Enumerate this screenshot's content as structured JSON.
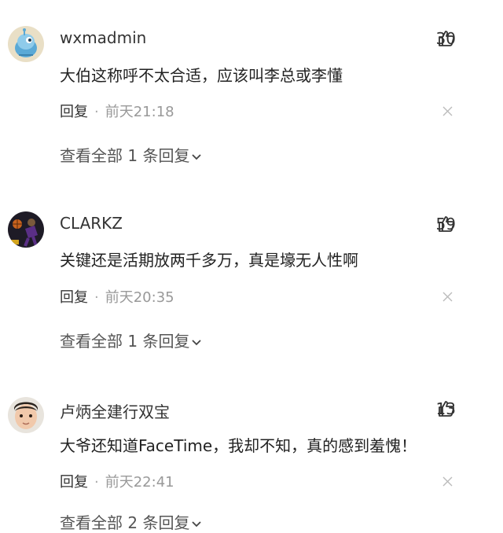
{
  "comments": [
    {
      "username": "wxmadmin",
      "likes": "30",
      "text": "大伯这称呼不太合适，应该叫李总或李懂",
      "reply_label": "回复",
      "separator": "·",
      "time": "前天21:18",
      "view_replies": "查看全部 1 条回复",
      "avatar_icon": "blue-robot-avatar"
    },
    {
      "username": "CLARKZ",
      "likes": "59",
      "text": "关键还是活期放两千多万，真是壕无人性啊",
      "reply_label": "回复",
      "separator": "·",
      "time": "前天20:35",
      "view_replies": "查看全部 1 条回复",
      "avatar_icon": "basketball-player-avatar"
    },
    {
      "username": "卢炳全建行双宝",
      "likes": "13",
      "text": "大爷还知道FaceTime，我却不知，真的感到羞愧！",
      "reply_label": "回复",
      "separator": "·",
      "time": "前天22:41",
      "view_replies": "查看全部 2 条回复",
      "avatar_icon": "child-photo-avatar"
    }
  ]
}
